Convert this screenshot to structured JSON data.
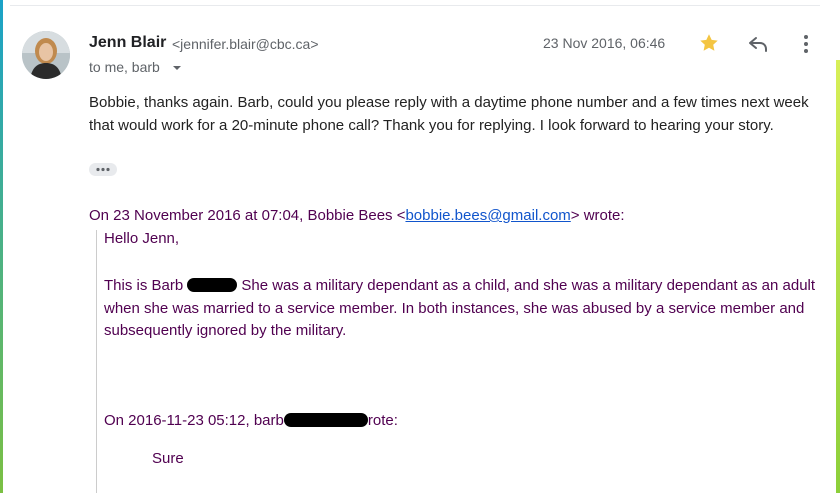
{
  "email": {
    "sender_name": "Jenn Blair",
    "sender_email": "<jennifer.blair@cbc.ca>",
    "date": "23 Nov 2016, 06:46",
    "recipients": "to me, barb",
    "body": "Bobbie, thanks again. Barb, could you please reply with a daytime phone number and a few times next week that would work for a 20-minute phone call? Thank you for replying. I look forward to hearing your story.",
    "starred": true
  },
  "quote": {
    "header_prefix": "On 23 November 2016 at 07:04, Bobbie Bees <",
    "header_link": "bobbie.bees@gmail.com",
    "header_suffix": "> wrote:",
    "greeting": "Hello Jenn,",
    "para_start": "This is Barb",
    "para_rest": " She was a military dependant as a child, and she was a military dependant as an adult when she was married to a service member.  In both instances, she was abused by a service member and subsequently ignored by the military.",
    "nested_prefix": "On 2016-11-23 05:12, barb",
    "nested_suffix": "rote:",
    "nested_reply": "Sure"
  },
  "colors": {
    "quoted_text": "#500050",
    "link": "#1155cc",
    "star": "#f4c542"
  }
}
